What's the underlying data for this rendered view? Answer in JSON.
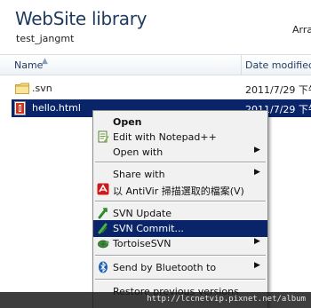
{
  "header": {
    "title": "WebSite library",
    "subtitle": "test_jangmt",
    "arrange_label": "Arra"
  },
  "columns": {
    "name": "Name",
    "date_modified": "Date modified"
  },
  "files": [
    {
      "name": ".svn",
      "date": "2011/7/29 下午",
      "type": "folder"
    },
    {
      "name": "hello.html",
      "date": "2011/7/29 下午",
      "type": "html",
      "selected": true
    }
  ],
  "context_menu": {
    "items": [
      {
        "label": "Open",
        "bold": true
      },
      {
        "label": "Edit with Notepad++",
        "icon": "notepad-icon"
      },
      {
        "label": "Open with",
        "submenu": true
      },
      {
        "label": "Share with",
        "submenu": true
      },
      {
        "label": "以 AntiVir 掃描選取的檔案(V)",
        "icon": "antivir-icon"
      },
      {
        "label": "SVN Update",
        "icon": "svn-update-icon"
      },
      {
        "label": "SVN Commit...",
        "icon": "svn-commit-icon",
        "highlighted": true
      },
      {
        "label": "TortoiseSVN",
        "icon": "tortoise-icon",
        "submenu": true
      },
      {
        "label": "Send by Bluetooth to",
        "icon": "bluetooth-icon",
        "submenu": true
      },
      {
        "label": "Restore previous versions"
      }
    ]
  },
  "watermark": "http://lccnetvip.pixnet.net/album",
  "colors": {
    "selection": "#0a246a",
    "title": "#1e3a5f",
    "menu_bg": "#f1f1f1"
  }
}
